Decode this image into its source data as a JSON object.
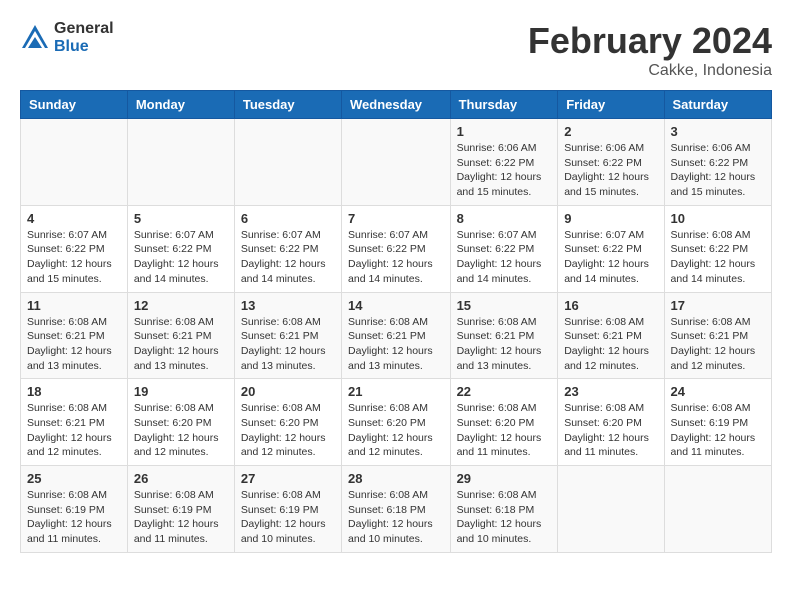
{
  "header": {
    "logo_general": "General",
    "logo_blue": "Blue",
    "month_title": "February 2024",
    "location": "Cakke, Indonesia"
  },
  "days_of_week": [
    "Sunday",
    "Monday",
    "Tuesday",
    "Wednesday",
    "Thursday",
    "Friday",
    "Saturday"
  ],
  "weeks": [
    [
      {
        "day": "",
        "info": ""
      },
      {
        "day": "",
        "info": ""
      },
      {
        "day": "",
        "info": ""
      },
      {
        "day": "",
        "info": ""
      },
      {
        "day": "1",
        "info": "Sunrise: 6:06 AM\nSunset: 6:22 PM\nDaylight: 12 hours\nand 15 minutes."
      },
      {
        "day": "2",
        "info": "Sunrise: 6:06 AM\nSunset: 6:22 PM\nDaylight: 12 hours\nand 15 minutes."
      },
      {
        "day": "3",
        "info": "Sunrise: 6:06 AM\nSunset: 6:22 PM\nDaylight: 12 hours\nand 15 minutes."
      }
    ],
    [
      {
        "day": "4",
        "info": "Sunrise: 6:07 AM\nSunset: 6:22 PM\nDaylight: 12 hours\nand 15 minutes."
      },
      {
        "day": "5",
        "info": "Sunrise: 6:07 AM\nSunset: 6:22 PM\nDaylight: 12 hours\nand 14 minutes."
      },
      {
        "day": "6",
        "info": "Sunrise: 6:07 AM\nSunset: 6:22 PM\nDaylight: 12 hours\nand 14 minutes."
      },
      {
        "day": "7",
        "info": "Sunrise: 6:07 AM\nSunset: 6:22 PM\nDaylight: 12 hours\nand 14 minutes."
      },
      {
        "day": "8",
        "info": "Sunrise: 6:07 AM\nSunset: 6:22 PM\nDaylight: 12 hours\nand 14 minutes."
      },
      {
        "day": "9",
        "info": "Sunrise: 6:07 AM\nSunset: 6:22 PM\nDaylight: 12 hours\nand 14 minutes."
      },
      {
        "day": "10",
        "info": "Sunrise: 6:08 AM\nSunset: 6:22 PM\nDaylight: 12 hours\nand 14 minutes."
      }
    ],
    [
      {
        "day": "11",
        "info": "Sunrise: 6:08 AM\nSunset: 6:21 PM\nDaylight: 12 hours\nand 13 minutes."
      },
      {
        "day": "12",
        "info": "Sunrise: 6:08 AM\nSunset: 6:21 PM\nDaylight: 12 hours\nand 13 minutes."
      },
      {
        "day": "13",
        "info": "Sunrise: 6:08 AM\nSunset: 6:21 PM\nDaylight: 12 hours\nand 13 minutes."
      },
      {
        "day": "14",
        "info": "Sunrise: 6:08 AM\nSunset: 6:21 PM\nDaylight: 12 hours\nand 13 minutes."
      },
      {
        "day": "15",
        "info": "Sunrise: 6:08 AM\nSunset: 6:21 PM\nDaylight: 12 hours\nand 13 minutes."
      },
      {
        "day": "16",
        "info": "Sunrise: 6:08 AM\nSunset: 6:21 PM\nDaylight: 12 hours\nand 12 minutes."
      },
      {
        "day": "17",
        "info": "Sunrise: 6:08 AM\nSunset: 6:21 PM\nDaylight: 12 hours\nand 12 minutes."
      }
    ],
    [
      {
        "day": "18",
        "info": "Sunrise: 6:08 AM\nSunset: 6:21 PM\nDaylight: 12 hours\nand 12 minutes."
      },
      {
        "day": "19",
        "info": "Sunrise: 6:08 AM\nSunset: 6:20 PM\nDaylight: 12 hours\nand 12 minutes."
      },
      {
        "day": "20",
        "info": "Sunrise: 6:08 AM\nSunset: 6:20 PM\nDaylight: 12 hours\nand 12 minutes."
      },
      {
        "day": "21",
        "info": "Sunrise: 6:08 AM\nSunset: 6:20 PM\nDaylight: 12 hours\nand 12 minutes."
      },
      {
        "day": "22",
        "info": "Sunrise: 6:08 AM\nSunset: 6:20 PM\nDaylight: 12 hours\nand 11 minutes."
      },
      {
        "day": "23",
        "info": "Sunrise: 6:08 AM\nSunset: 6:20 PM\nDaylight: 12 hours\nand 11 minutes."
      },
      {
        "day": "24",
        "info": "Sunrise: 6:08 AM\nSunset: 6:19 PM\nDaylight: 12 hours\nand 11 minutes."
      }
    ],
    [
      {
        "day": "25",
        "info": "Sunrise: 6:08 AM\nSunset: 6:19 PM\nDaylight: 12 hours\nand 11 minutes."
      },
      {
        "day": "26",
        "info": "Sunrise: 6:08 AM\nSunset: 6:19 PM\nDaylight: 12 hours\nand 11 minutes."
      },
      {
        "day": "27",
        "info": "Sunrise: 6:08 AM\nSunset: 6:19 PM\nDaylight: 12 hours\nand 10 minutes."
      },
      {
        "day": "28",
        "info": "Sunrise: 6:08 AM\nSunset: 6:18 PM\nDaylight: 12 hours\nand 10 minutes."
      },
      {
        "day": "29",
        "info": "Sunrise: 6:08 AM\nSunset: 6:18 PM\nDaylight: 12 hours\nand 10 minutes."
      },
      {
        "day": "",
        "info": ""
      },
      {
        "day": "",
        "info": ""
      }
    ]
  ]
}
